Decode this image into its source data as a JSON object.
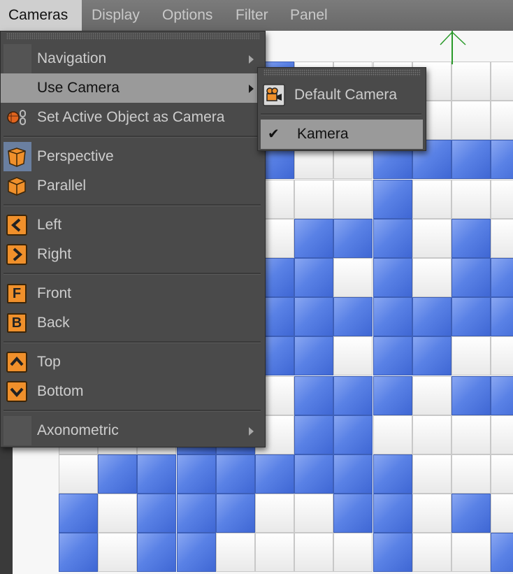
{
  "menubar": {
    "items": [
      "Cameras",
      "Display",
      "Options",
      "Filter",
      "Panel"
    ],
    "active": "Cameras"
  },
  "cameras_menu": {
    "navigation": "Navigation",
    "use_camera": "Use Camera",
    "set_active": "Set Active Object as Camera",
    "perspective": "Perspective",
    "parallel": "Parallel",
    "left": "Left",
    "right": "Right",
    "front": "Front",
    "front_key": "F",
    "back": "Back",
    "back_key": "B",
    "top": "Top",
    "bottom": "Bottom",
    "axonometric": "Axonometric"
  },
  "use_camera_submenu": {
    "default_camera": "Default Camera",
    "kamera": "Kamera",
    "checkmark": "✔",
    "selected": "Kamera"
  },
  "viewport": {
    "grid_rows": [
      "WWWBBBWWWWWW",
      "WWWBBBWBBWWW",
      "WWWWWBWWBBBB",
      "WWWBWWWWBWWW",
      "WWWBWWBBBWBW",
      "WWWBBBBWBWBB",
      "WWWBBBBBBBBB",
      "WWWWBBBWBBWW",
      "WWWBBWBBBWBB",
      "WWWBBWBBWWWW",
      "WBBBBBBBBWWW",
      "BWBBBWWBBWBW",
      "BWBBWWWWBWWB"
    ],
    "colors": {
      "blue": "#5a82e6",
      "white": "#f7f7f7"
    }
  },
  "colors": {
    "menubar_bg": "#6e6e6e",
    "menu_bg": "#4a4a4a",
    "highlight": "#9a9a9a",
    "orange": "#f0902b"
  }
}
